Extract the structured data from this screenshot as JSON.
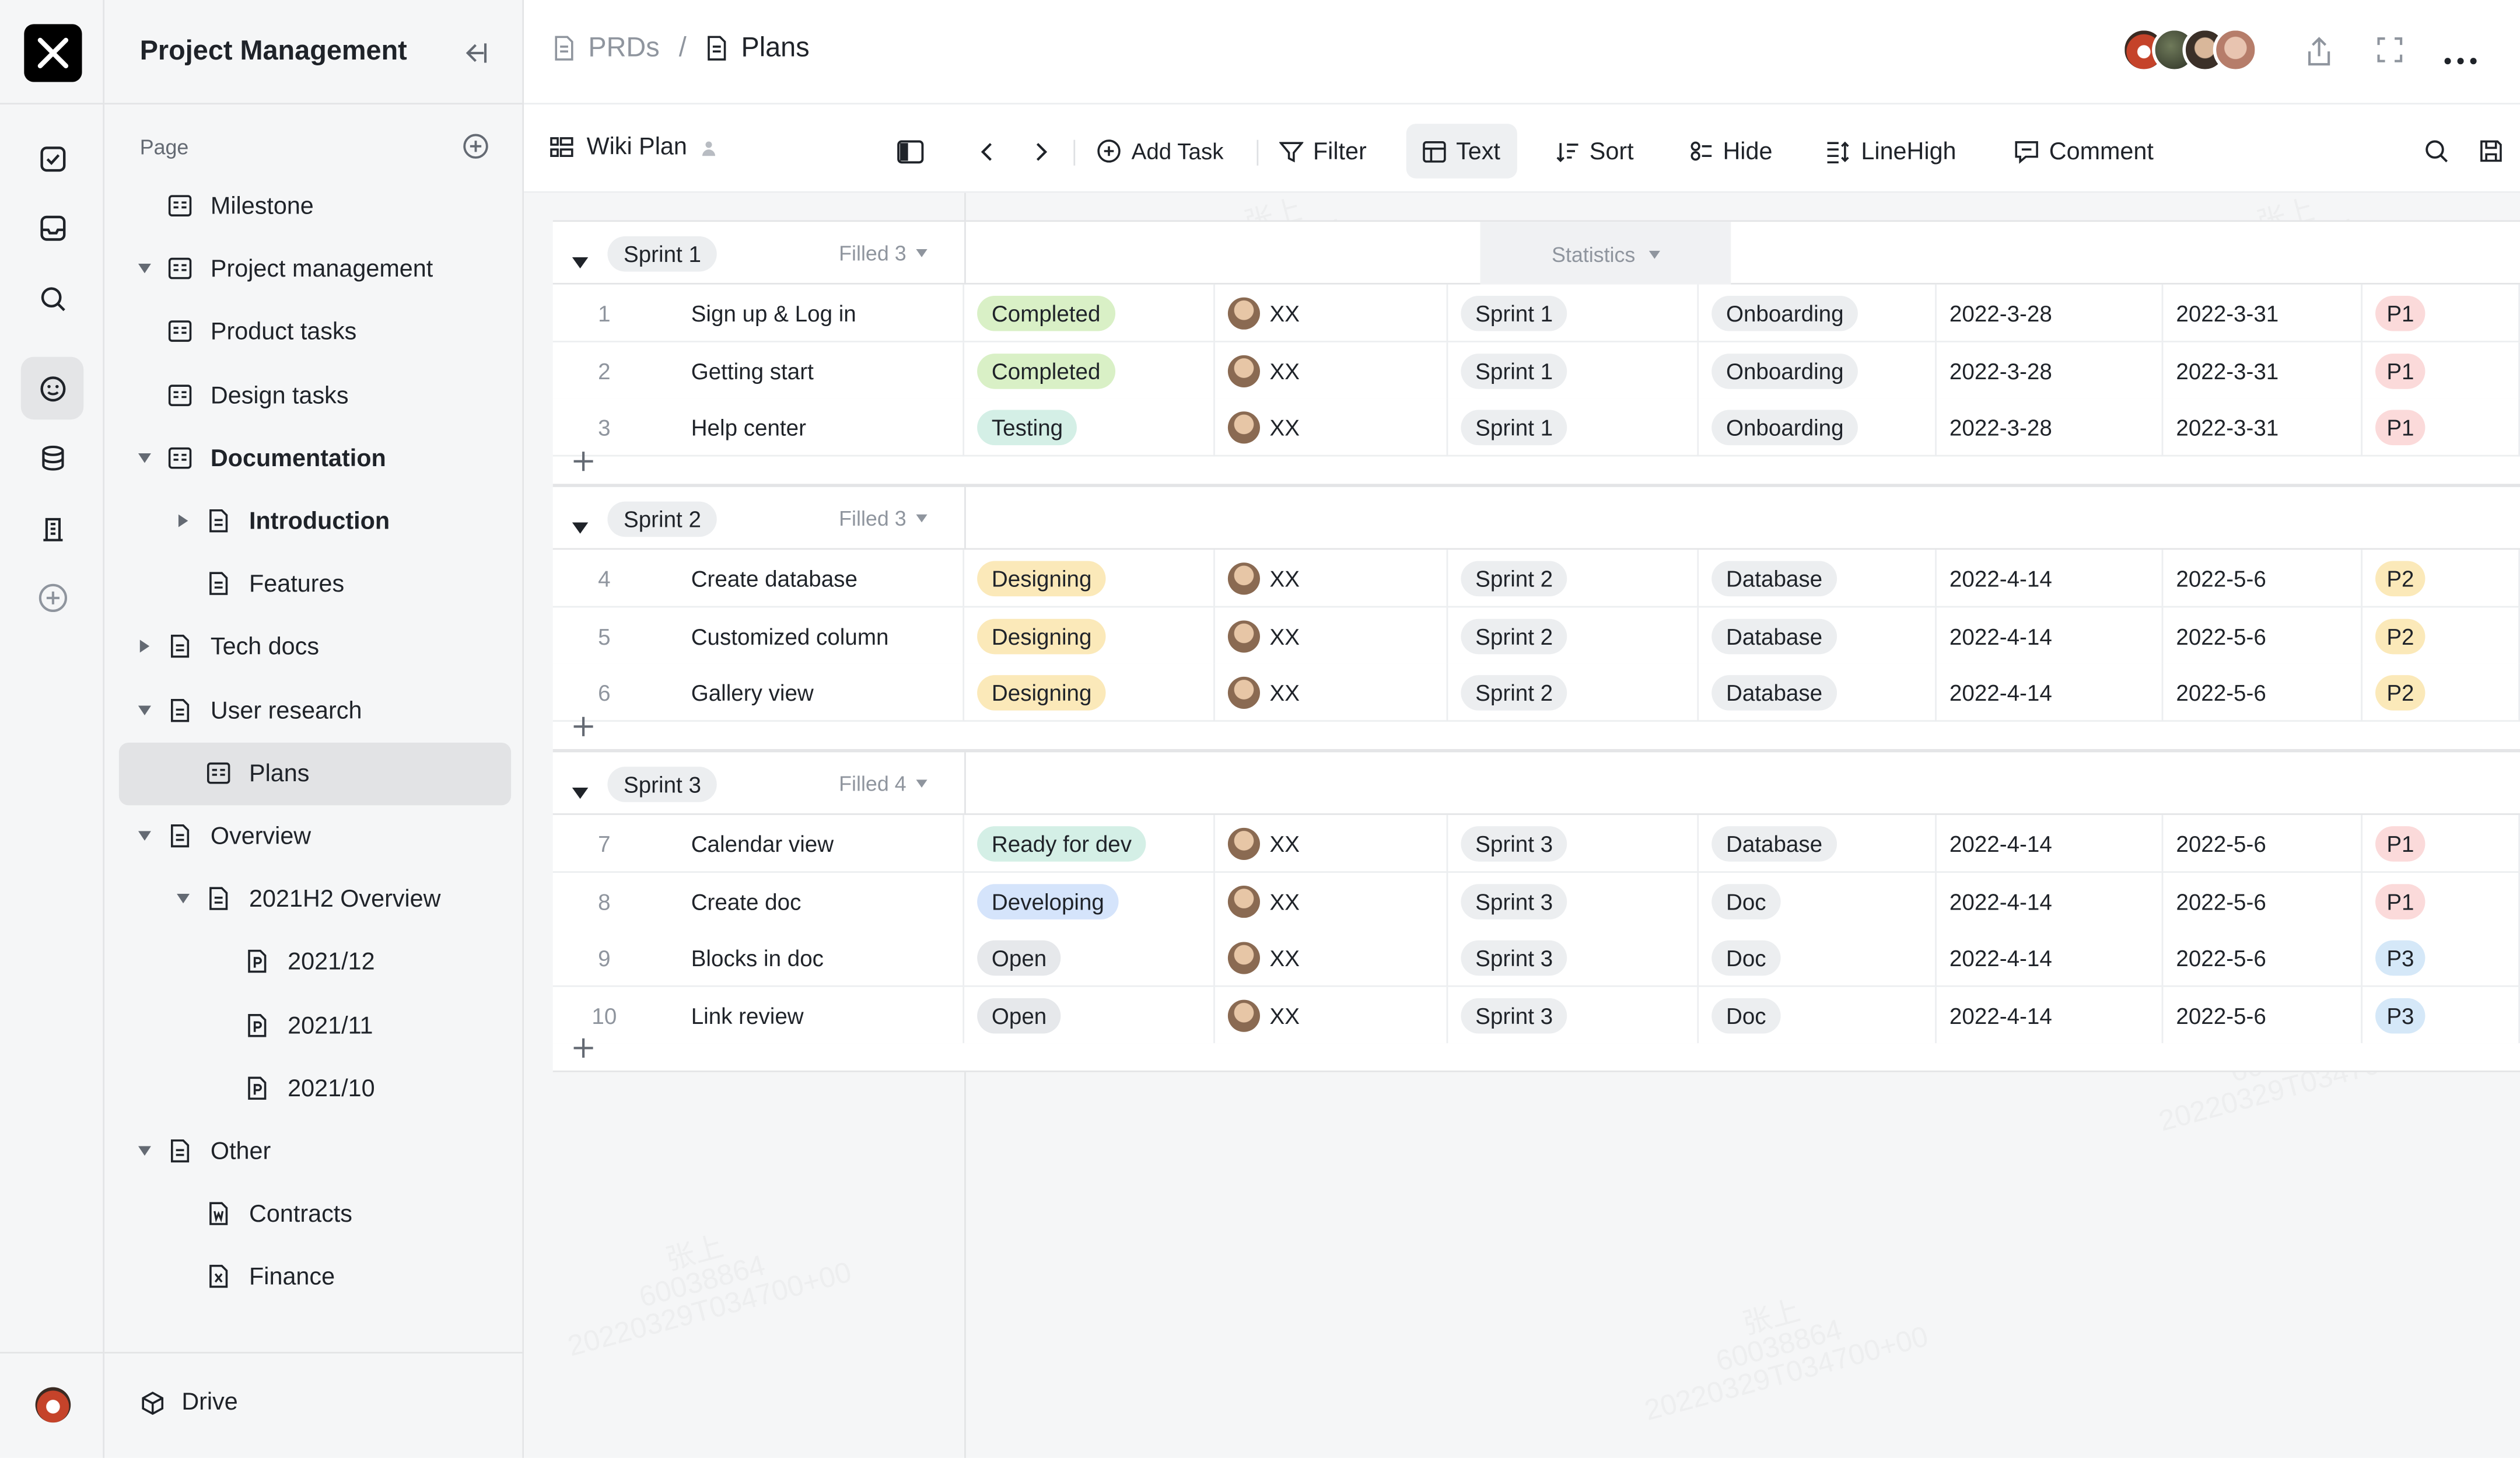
{
  "sidebar": {
    "title": "Project Management",
    "section_label": "Page",
    "items": [
      {
        "label": "Milestone",
        "level": 0,
        "caret": "none",
        "icon": "board"
      },
      {
        "label": "Project management",
        "level": 0,
        "caret": "down",
        "icon": "board"
      },
      {
        "label": "Product tasks",
        "level": 0,
        "caret": "none",
        "icon": "board"
      },
      {
        "label": "Design tasks",
        "level": 0,
        "caret": "none",
        "icon": "board"
      },
      {
        "label": "Documentation",
        "level": 0,
        "caret": "down",
        "icon": "board"
      },
      {
        "label": "Introduction",
        "level": 1,
        "caret": "right",
        "icon": "doc"
      },
      {
        "label": "Features",
        "level": 1,
        "caret": "none",
        "icon": "doc"
      },
      {
        "label": "Tech docs",
        "level": 0,
        "caret": "right",
        "icon": "doc"
      },
      {
        "label": "User research",
        "level": 0,
        "caret": "down",
        "icon": "doc"
      },
      {
        "label": "Plans",
        "level": 1,
        "caret": "none",
        "icon": "board",
        "active": true
      },
      {
        "label": "Overview",
        "level": 0,
        "caret": "down",
        "icon": "doc"
      },
      {
        "label": "2021H2 Overview",
        "level": 1,
        "caret": "down",
        "icon": "doc"
      },
      {
        "label": "2021/12",
        "level": 2,
        "caret": "none",
        "icon": "p"
      },
      {
        "label": "2021/11",
        "level": 2,
        "caret": "none",
        "icon": "p"
      },
      {
        "label": "2021/10",
        "level": 2,
        "caret": "none",
        "icon": "p"
      },
      {
        "label": "Other",
        "level": 0,
        "caret": "down",
        "icon": "doc"
      },
      {
        "label": "Contracts",
        "level": 1,
        "caret": "none",
        "icon": "w"
      },
      {
        "label": "Finance",
        "level": 1,
        "caret": "none",
        "icon": "x"
      }
    ],
    "drive_label": "Drive"
  },
  "breadcrumb": {
    "parent": "PRDs",
    "separator": "/",
    "current": "Plans"
  },
  "toolbar": {
    "view_name": "Wiki Plan",
    "add_task": "Add Task",
    "filter": "Filter",
    "text": "Text",
    "sort": "Sort",
    "hide": "Hide",
    "linehigh": "LineHigh",
    "comment": "Comment"
  },
  "statistics_label": "Statistics",
  "watermark": [
    "张上",
    "60038864",
    "20220329T034700+00"
  ],
  "groups": [
    {
      "name": "Sprint 1",
      "filled": "Filled 3",
      "rows": [
        {
          "num": "1",
          "title": "Sign up & Log in",
          "status": "Completed",
          "owner": "XX",
          "sprint": "Sprint 1",
          "module": "Onboarding",
          "start": "2022-3-28",
          "end": "2022-3-31",
          "priority": "P1"
        },
        {
          "num": "2",
          "title": "Getting start",
          "status": "Completed",
          "owner": "XX",
          "sprint": "Sprint 1",
          "module": "Onboarding",
          "start": "2022-3-28",
          "end": "2022-3-31",
          "priority": "P1"
        },
        {
          "num": "3",
          "title": "Help center",
          "status": "Testing",
          "owner": "XX",
          "sprint": "Sprint 1",
          "module": "Onboarding",
          "start": "2022-3-28",
          "end": "2022-3-31",
          "priority": "P1"
        }
      ]
    },
    {
      "name": "Sprint 2",
      "filled": "Filled 3",
      "rows": [
        {
          "num": "4",
          "title": "Create database",
          "status": "Designing",
          "owner": "XX",
          "sprint": "Sprint 2",
          "module": "Database",
          "start": "2022-4-14",
          "end": "2022-5-6",
          "priority": "P2"
        },
        {
          "num": "5",
          "title": "Customized column",
          "status": "Designing",
          "owner": "XX",
          "sprint": "Sprint 2",
          "module": "Database",
          "start": "2022-4-14",
          "end": "2022-5-6",
          "priority": "P2"
        },
        {
          "num": "6",
          "title": "Gallery view",
          "status": "Designing",
          "owner": "XX",
          "sprint": "Sprint 2",
          "module": "Database",
          "start": "2022-4-14",
          "end": "2022-5-6",
          "priority": "P2"
        }
      ]
    },
    {
      "name": "Sprint 3",
      "filled": "Filled 4",
      "rows": [
        {
          "num": "7",
          "title": "Calendar view",
          "status": "Ready for dev",
          "owner": "XX",
          "sprint": "Sprint 3",
          "module": "Database",
          "start": "2022-4-14",
          "end": "2022-5-6",
          "priority": "P1"
        },
        {
          "num": "8",
          "title": "Create doc",
          "status": "Developing",
          "owner": "XX",
          "sprint": "Sprint 3",
          "module": "Doc",
          "start": "2022-4-14",
          "end": "2022-5-6",
          "priority": "P1"
        },
        {
          "num": "9",
          "title": "Blocks in doc",
          "status": "Open",
          "owner": "XX",
          "sprint": "Sprint 3",
          "module": "Doc",
          "start": "2022-4-14",
          "end": "2022-5-6",
          "priority": "P3"
        },
        {
          "num": "10",
          "title": "Link review",
          "status": "Open",
          "owner": "XX",
          "sprint": "Sprint 3",
          "module": "Doc",
          "start": "2022-4-14",
          "end": "2022-5-6",
          "priority": "P3"
        }
      ]
    }
  ],
  "colors": {
    "status": {
      "Completed": "#d9f0c6",
      "Testing": "#d4efe6",
      "Designing": "#fbe9b9",
      "Ready for dev": "#d4efe6",
      "Developing": "#d5e4fb",
      "Open": "#e6e8eb"
    },
    "priority": {
      "P1": "#fbdada",
      "P2": "#fbe9b9",
      "P3": "#d5e8f8"
    },
    "chip": "#eceef0"
  }
}
